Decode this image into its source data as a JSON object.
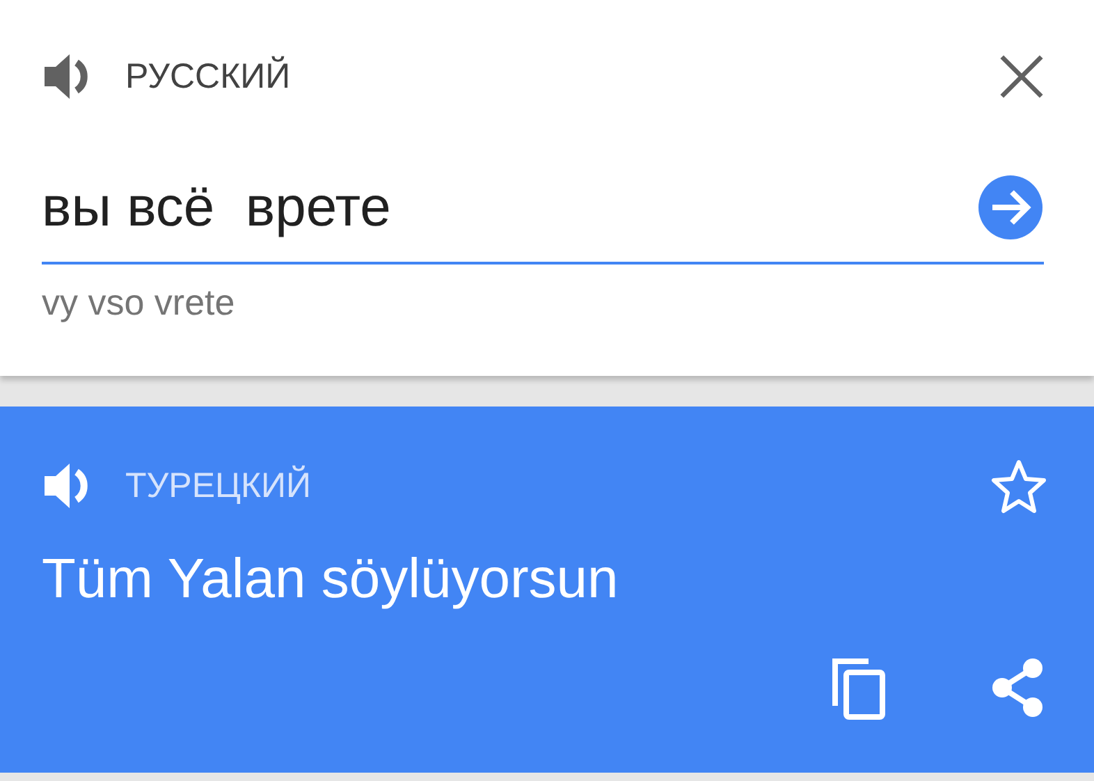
{
  "source": {
    "language": "РУССКИЙ",
    "text": "вы всё  врете",
    "transliteration": "vy vso vrete"
  },
  "target": {
    "language": "ТУРЕЦКИЙ",
    "text": "Tüm Yalan söylüyorsun",
    "starred": false
  }
}
